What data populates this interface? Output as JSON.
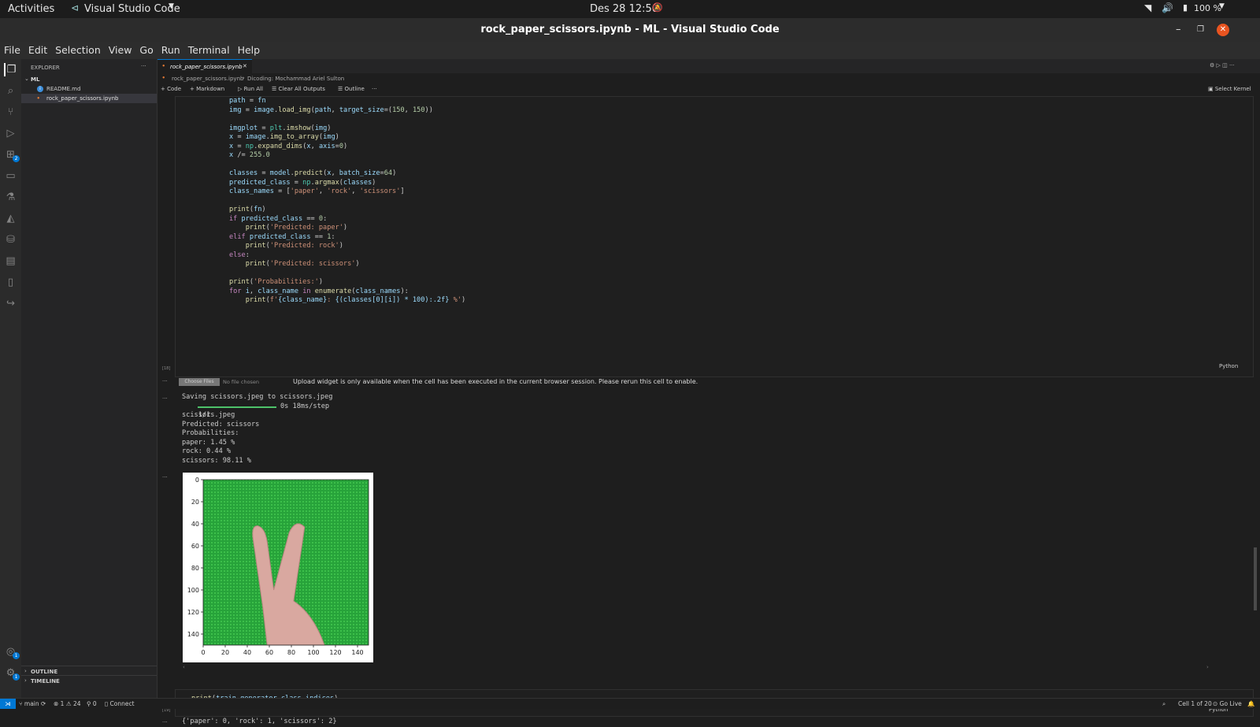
{
  "os_bar": {
    "activities": "Activities",
    "app_name": "Visual Studio Code",
    "clock": "Des 28  12:50",
    "battery": "100 %"
  },
  "window": {
    "title": "rock_paper_scissors.ipynb - ML - Visual Studio Code"
  },
  "menu": [
    "File",
    "Edit",
    "Selection",
    "View",
    "Go",
    "Run",
    "Terminal",
    "Help"
  ],
  "explorer": {
    "header": "EXPLORER",
    "folder": "ML",
    "files": [
      "README.md",
      "rock_paper_scissors.ipynb"
    ],
    "outline": "OUTLINE",
    "timeline": "TIMELINE"
  },
  "activity_badges": {
    "extensions": "2",
    "accounts": "1",
    "settings": "1"
  },
  "editor": {
    "tab": "rock_paper_scissors.ipynb",
    "breadcrumb": [
      "rock_paper_scissors.ipynb",
      "Dicoding: Mochammad Ariel Sulton"
    ],
    "toolbar": {
      "code": "Code",
      "markdown": "Markdown",
      "run_all": "Run All",
      "clear": "Clear All Outputs",
      "outline": "Outline",
      "more": "···",
      "kernel": "Select Kernel"
    },
    "cell1": {
      "lines": [
        "path = fn",
        "img = image.load_img(path, target_size=(150, 150))",
        "",
        "imgplot = plt.imshow(img)",
        "x = image.img_to_array(img)",
        "x = np.expand_dims(x, axis=0)",
        "x /= 255.0",
        "",
        "classes = model.predict(x, batch_size=64)",
        "predicted_class = np.argmax(classes)",
        "class_names = ['paper', 'rock', 'scissors']",
        "",
        "print(fn)",
        "if predicted_class == 0:",
        "    print('Predicted: paper')",
        "elif predicted_class == 1:",
        "    print('Predicted: rock')",
        "else:",
        "    print('Predicted: scissors')",
        "",
        "print('Probabilities:')",
        "for i, class_name in enumerate(class_names):",
        "    print(f'{class_name}: {(classes[0][i]) * 100):.2f} %')"
      ],
      "exec_count": "[18]",
      "lang": "Python"
    },
    "upload": {
      "button": "Choose Files",
      "status": "No file chosen",
      "message": "Upload widget is only available when the cell has been executed in the current browser session. Please rerun this cell to enable."
    },
    "output_text": {
      "saving": "Saving scissors.jpeg to scissors.jpeg",
      "progress_left": "1/1",
      "progress_right": "0s 18ms/step",
      "lines": [
        "scissors.jpeg",
        "Predicted: scissors",
        "Probabilities:",
        "paper: 1.45 %",
        "rock: 0.44 %",
        "scissors: 98.11 %"
      ]
    },
    "cell2": {
      "code": "print(train_generator.class_indices)",
      "exec_count": "[19]",
      "lang": "Python",
      "output": "{'paper': 0, 'rock': 1, 'scissors': 2}"
    },
    "output_more": "···"
  },
  "chart_data": {
    "type": "heatmap",
    "title": "",
    "xlabel": "",
    "ylabel": "",
    "x_ticks": [
      0,
      20,
      40,
      60,
      80,
      100,
      120,
      140
    ],
    "y_ticks": [
      0,
      20,
      40,
      60,
      80,
      100,
      120,
      140
    ],
    "xlim": [
      0,
      150
    ],
    "ylim": [
      150,
      0
    ],
    "image": "scissors hand on green background",
    "colors": {
      "background": "#27a33a",
      "hand": "#d9a8a0"
    }
  },
  "status": {
    "branch": "main",
    "errors": "1",
    "warnings": "24",
    "ports": "0",
    "connect": "Connect",
    "cell": "Cell 1 of 20",
    "golive": "Go Live"
  }
}
